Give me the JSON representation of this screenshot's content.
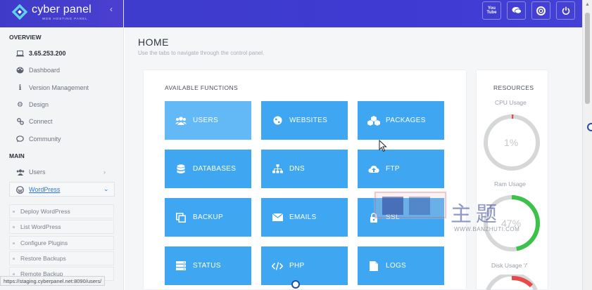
{
  "brand": {
    "name": "cyber panel",
    "subtitle": "WEB HOSTING PANEL",
    "collapse_glyph": "‹"
  },
  "sidebar": {
    "overview_label": "OVERVIEW",
    "ip": "3.65.253.200",
    "overview_items": [
      {
        "label": "Dashboard",
        "icon": "palette-icon"
      },
      {
        "label": "Version Management",
        "icon": "info-icon"
      },
      {
        "label": "Design",
        "icon": "gear-icon"
      },
      {
        "label": "Connect",
        "icon": "link-icon"
      },
      {
        "label": "Community",
        "icon": "chat-icon"
      }
    ],
    "main_label": "MAIN",
    "users_label": "Users",
    "wordpress_label": "WordPress",
    "wordpress_sub": [
      "Deploy WordPress",
      "List WordPress",
      "Configure Plugins",
      "Restore Backups",
      "Remote Backup"
    ]
  },
  "topbar": {
    "icons": [
      "youtube-icon",
      "chat-icon",
      "support-icon",
      "power-icon"
    ],
    "youtube_text": "You Tube"
  },
  "home": {
    "title": "HOME",
    "subtitle": "Use the tabs to navigate through the control panel."
  },
  "functions": {
    "title": "AVAILABLE FUNCTIONS",
    "tiles": [
      {
        "label": "USERS",
        "icon": "users-icon"
      },
      {
        "label": "WEBSITES",
        "icon": "globe-icon"
      },
      {
        "label": "PACKAGES",
        "icon": "cubes-icon"
      },
      {
        "label": "DATABASES",
        "icon": "database-icon"
      },
      {
        "label": "DNS",
        "icon": "sitemap-icon"
      },
      {
        "label": "FTP",
        "icon": "cloud-upload-icon"
      },
      {
        "label": "BACKUP",
        "icon": "copy-icon"
      },
      {
        "label": "EMAILS",
        "icon": "envelope-icon"
      },
      {
        "label": "SSL",
        "icon": "lock-icon"
      },
      {
        "label": "STATUS",
        "icon": "server-icon"
      },
      {
        "label": "PHP",
        "icon": "code-icon"
      },
      {
        "label": "LOGS",
        "icon": "file-icon"
      }
    ]
  },
  "resources": {
    "title": "RESOURCES",
    "cpu_label": "CPU Usage",
    "cpu_value": "1%",
    "cpu_fraction": 0.01,
    "ram_label": "Ram Usage",
    "ram_value": "47%",
    "ram_fraction": 0.47,
    "disk_label": "Disk Usage '/'"
  },
  "watermark": {
    "cn": "主题",
    "url": "WWW.BANZHUTI.COM"
  },
  "status_bar": {
    "url": "https://staging.cyberpanel.net:8090/users/"
  },
  "colors": {
    "accent": "#3fa7f2",
    "brand": "#3f3bc8",
    "gauge_green": "#3cc14b",
    "gauge_red": "#e84a4a",
    "gauge_track": "#d6d7d9"
  }
}
